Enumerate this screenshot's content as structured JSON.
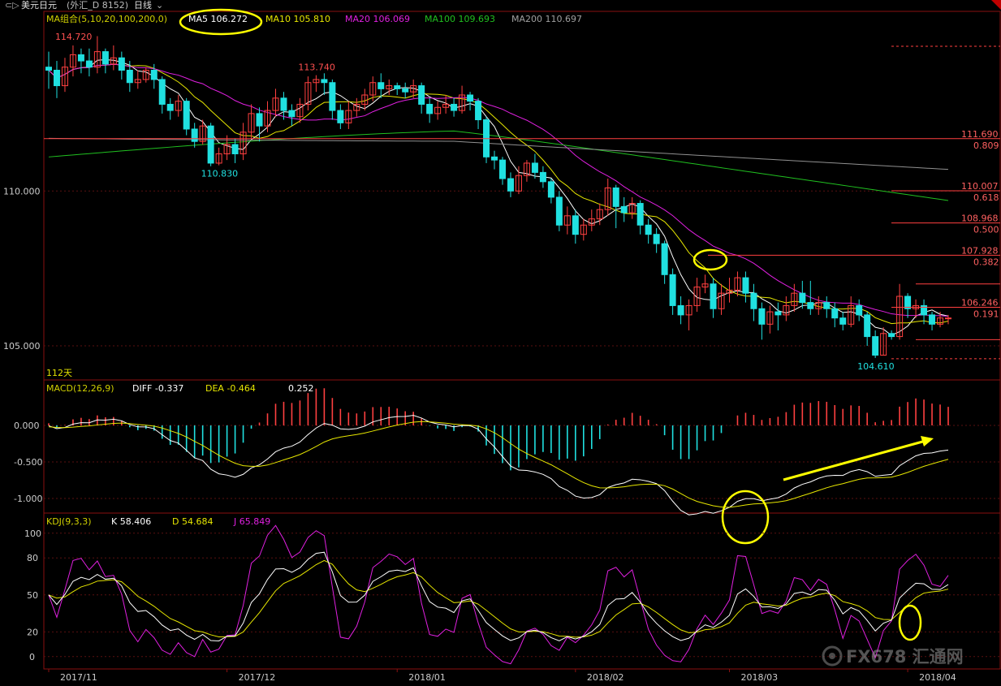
{
  "window": {
    "symbol_text": "美元日元",
    "symbol_suffix": "(外汇_D 8152)",
    "period_label": "日线",
    "back_icon": "back-arrow-icon",
    "period_icon": "chevron-down-icon"
  },
  "legend": {
    "ma_label": "MA组合(5,10,20,100,200,0)",
    "ma5": "MA5 106.272",
    "ma10": "MA10 105.810",
    "ma20": "MA20 106.069",
    "ma100": "MA100 109.693",
    "ma200": "MA200 110.697",
    "macd_label": "MACD(12,26,9)",
    "diff": "DIFF  -0.337",
    "dea": "DEA  -0.464",
    "macd_val": "0.252",
    "kdj_label": "KDJ(9,3,3)",
    "k": "K  58.406",
    "d": "D  54.684",
    "j": "J  65.849",
    "days_label": "112天"
  },
  "colors": {
    "up": "#ff4040",
    "down": "#20e0e0",
    "ma5": "#ffffff",
    "ma10": "#e6e600",
    "ma20": "#e020e0",
    "ma100": "#20c020",
    "ma200": "#909090",
    "fib": "#ff4040",
    "annotation": "#ffff00"
  },
  "chart_data": [
    {
      "type": "candlestick",
      "title": "美元日元",
      "x_labels": [
        "2017/11",
        "2017/12",
        "2018/01",
        "2018/02",
        "2018/03",
        "2018/04"
      ],
      "y_ticks": [
        "110.000",
        "105.000"
      ],
      "ylim": [
        103.9,
        115.8
      ],
      "price_annotations": [
        {
          "text": "114.720",
          "value": 114.72
        },
        {
          "text": "110.830",
          "value": 110.83
        },
        {
          "text": "113.740",
          "value": 113.74
        },
        {
          "text": "104.610",
          "value": 104.61
        }
      ],
      "fibonacci": [
        {
          "price": "111.690",
          "ratio": "0.809",
          "value": 111.69
        },
        {
          "price": "110.007",
          "ratio": "0.618",
          "value": 110.007
        },
        {
          "price": "108.968",
          "ratio": "0.500",
          "value": 108.968
        },
        {
          "price": "107.928",
          "ratio": "0.382",
          "value": 107.928
        },
        {
          "price": "106.246",
          "ratio": "0.191",
          "value": 106.246
        }
      ],
      "candles": [
        [
          114.0,
          113.9,
          114.5,
          113.3
        ],
        [
          113.9,
          113.4,
          114.2,
          113.0
        ],
        [
          113.4,
          114.0,
          114.3,
          113.2
        ],
        [
          114.0,
          114.4,
          114.7,
          113.7
        ],
        [
          114.4,
          114.2,
          114.6,
          113.8
        ],
        [
          114.2,
          114.0,
          114.6,
          113.7
        ],
        [
          114.0,
          114.5,
          115.0,
          113.8
        ],
        [
          114.5,
          114.1,
          114.6,
          113.8
        ],
        [
          114.1,
          114.3,
          114.7,
          113.9
        ],
        [
          114.3,
          113.9,
          114.5,
          113.6
        ],
        [
          113.9,
          113.5,
          114.2,
          113.2
        ],
        [
          113.5,
          113.6,
          113.9,
          113.3
        ],
        [
          113.6,
          113.9,
          114.0,
          113.5
        ],
        [
          113.9,
          113.6,
          114.1,
          113.3
        ],
        [
          113.6,
          112.8,
          113.7,
          112.5
        ],
        [
          112.8,
          112.6,
          113.0,
          112.3
        ],
        [
          112.6,
          112.9,
          113.1,
          112.4
        ],
        [
          112.9,
          112.0,
          113.0,
          111.8
        ],
        [
          112.0,
          111.6,
          112.2,
          111.4
        ],
        [
          111.6,
          112.1,
          112.3,
          111.5
        ],
        [
          112.1,
          110.9,
          112.2,
          110.8
        ],
        [
          110.9,
          111.2,
          111.4,
          110.83
        ],
        [
          111.2,
          111.5,
          111.8,
          111.0
        ],
        [
          111.5,
          111.2,
          111.7,
          110.9
        ],
        [
          111.2,
          111.9,
          112.2,
          111.0
        ],
        [
          111.9,
          112.5,
          112.8,
          111.7
        ],
        [
          112.5,
          112.1,
          112.7,
          111.6
        ],
        [
          112.1,
          112.6,
          112.9,
          111.9
        ],
        [
          112.6,
          113.0,
          113.3,
          112.4
        ],
        [
          113.0,
          112.6,
          113.2,
          112.3
        ],
        [
          112.6,
          112.4,
          112.8,
          112.1
        ],
        [
          112.4,
          112.8,
          113.0,
          112.2
        ],
        [
          112.8,
          113.5,
          113.7,
          112.6
        ],
        [
          113.5,
          113.6,
          113.74,
          113.2
        ],
        [
          113.6,
          113.5,
          113.8,
          113.1
        ],
        [
          113.5,
          112.6,
          113.6,
          112.3
        ],
        [
          112.6,
          112.2,
          112.8,
          112.0
        ],
        [
          112.2,
          112.6,
          112.9,
          112.0
        ],
        [
          112.6,
          112.8,
          113.0,
          112.4
        ],
        [
          112.8,
          113.1,
          113.3,
          112.6
        ],
        [
          113.1,
          113.5,
          113.7,
          112.9
        ],
        [
          113.5,
          113.3,
          113.8,
          113.0
        ],
        [
          113.3,
          113.4,
          113.6,
          113.1
        ],
        [
          113.4,
          113.3,
          113.5,
          113.1
        ],
        [
          113.3,
          113.2,
          113.5,
          113.0
        ],
        [
          113.2,
          113.4,
          113.6,
          113.0
        ],
        [
          113.4,
          112.8,
          113.5,
          112.5
        ],
        [
          112.8,
          112.5,
          113.0,
          112.2
        ],
        [
          112.5,
          112.7,
          112.9,
          112.3
        ],
        [
          112.7,
          112.8,
          113.1,
          112.5
        ],
        [
          112.8,
          112.6,
          113.0,
          112.4
        ],
        [
          112.6,
          113.1,
          113.4,
          112.5
        ],
        [
          113.1,
          112.9,
          113.2,
          112.6
        ],
        [
          112.9,
          112.3,
          113.0,
          112.0
        ],
        [
          112.3,
          111.1,
          112.4,
          110.9
        ],
        [
          111.1,
          111.0,
          111.3,
          110.7
        ],
        [
          111.0,
          110.4,
          111.1,
          110.2
        ],
        [
          110.4,
          110.0,
          110.6,
          109.8
        ],
        [
          110.0,
          110.5,
          110.8,
          109.9
        ],
        [
          110.5,
          110.9,
          111.0,
          110.3
        ],
        [
          110.9,
          110.6,
          111.2,
          110.4
        ],
        [
          110.6,
          110.3,
          110.8,
          110.1
        ],
        [
          110.3,
          109.8,
          110.4,
          109.6
        ],
        [
          109.8,
          108.9,
          110.0,
          108.7
        ],
        [
          108.9,
          109.2,
          109.5,
          108.6
        ],
        [
          109.2,
          108.6,
          109.4,
          108.3
        ],
        [
          108.6,
          108.9,
          109.1,
          108.4
        ],
        [
          108.9,
          109.1,
          109.4,
          108.7
        ],
        [
          109.1,
          109.4,
          109.6,
          108.9
        ],
        [
          109.4,
          110.1,
          110.4,
          109.2
        ],
        [
          110.1,
          109.5,
          110.2,
          108.8
        ],
        [
          109.5,
          109.3,
          109.8,
          109.0
        ],
        [
          109.3,
          109.6,
          109.8,
          109.1
        ],
        [
          109.6,
          108.9,
          109.7,
          108.6
        ],
        [
          108.9,
          108.6,
          109.1,
          108.3
        ],
        [
          108.6,
          108.3,
          108.8,
          108.0
        ],
        [
          108.3,
          107.3,
          108.4,
          107.0
        ],
        [
          107.3,
          106.3,
          107.5,
          106.0
        ],
        [
          106.3,
          106.0,
          106.6,
          105.7
        ],
        [
          106.0,
          106.3,
          106.5,
          105.5
        ],
        [
          106.3,
          106.9,
          107.2,
          106.1
        ],
        [
          106.9,
          107.0,
          107.3,
          106.7
        ],
        [
          107.0,
          106.2,
          107.2,
          105.9
        ],
        [
          106.2,
          106.7,
          107.0,
          106.0
        ],
        [
          106.7,
          106.8,
          107.2,
          106.4
        ],
        [
          106.8,
          107.2,
          107.4,
          106.6
        ],
        [
          107.2,
          106.7,
          107.4,
          106.4
        ],
        [
          106.7,
          106.2,
          107.0,
          105.8
        ],
        [
          106.2,
          105.7,
          106.4,
          105.2
        ],
        [
          105.7,
          106.1,
          106.3,
          105.4
        ],
        [
          106.1,
          106.0,
          106.4,
          105.5
        ],
        [
          106.0,
          106.3,
          106.6,
          105.8
        ],
        [
          106.3,
          106.7,
          107.0,
          106.1
        ],
        [
          106.7,
          106.4,
          107.1,
          106.2
        ],
        [
          106.4,
          106.2,
          107.1,
          106.0
        ],
        [
          106.2,
          106.4,
          106.6,
          106.0
        ],
        [
          106.4,
          106.2,
          106.6,
          105.9
        ],
        [
          106.2,
          105.9,
          106.4,
          105.6
        ],
        [
          105.9,
          105.7,
          106.1,
          105.5
        ],
        [
          105.7,
          106.3,
          106.6,
          105.6
        ],
        [
          106.3,
          106.0,
          106.5,
          105.8
        ],
        [
          106.0,
          105.3,
          106.1,
          105.0
        ],
        [
          105.3,
          104.7,
          105.5,
          104.61
        ],
        [
          104.7,
          105.4,
          105.6,
          104.7
        ],
        [
          105.4,
          105.3,
          105.5,
          105.2
        ],
        [
          105.3,
          106.6,
          107.0,
          105.2
        ],
        [
          106.6,
          106.2,
          106.7,
          105.9
        ],
        [
          106.2,
          106.3,
          106.5,
          105.9
        ],
        [
          106.3,
          106.0,
          106.5,
          105.7
        ],
        [
          106.0,
          105.7,
          106.1,
          105.5
        ],
        [
          105.7,
          105.9,
          106.1,
          105.6
        ],
        [
          105.9,
          105.9,
          106.0,
          105.7
        ]
      ],
      "ma_end_values": {
        "MA5": 106.272,
        "MA10": 105.81,
        "MA20": 106.069,
        "MA100": 109.693,
        "MA200": 110.697
      }
    },
    {
      "type": "bar",
      "title": "MACD(12,26,9)",
      "y_ticks": [
        "0.000",
        "-0.500",
        "-1.000"
      ],
      "ylim": [
        -1.2,
        0.6
      ],
      "diff_last": -0.337,
      "dea_last": -0.464,
      "macd_last": 0.252
    },
    {
      "type": "line",
      "title": "KDJ(9,3,3)",
      "y_ticks": [
        "100",
        "80",
        "50",
        "20",
        "0"
      ],
      "ylim": [
        -10,
        115
      ],
      "k_last": 58.406,
      "d_last": 54.684,
      "j_last": 65.849
    }
  ],
  "watermark": {
    "brand_icon": "fx678-logo-icon",
    "text": "FX678 汇通网"
  }
}
